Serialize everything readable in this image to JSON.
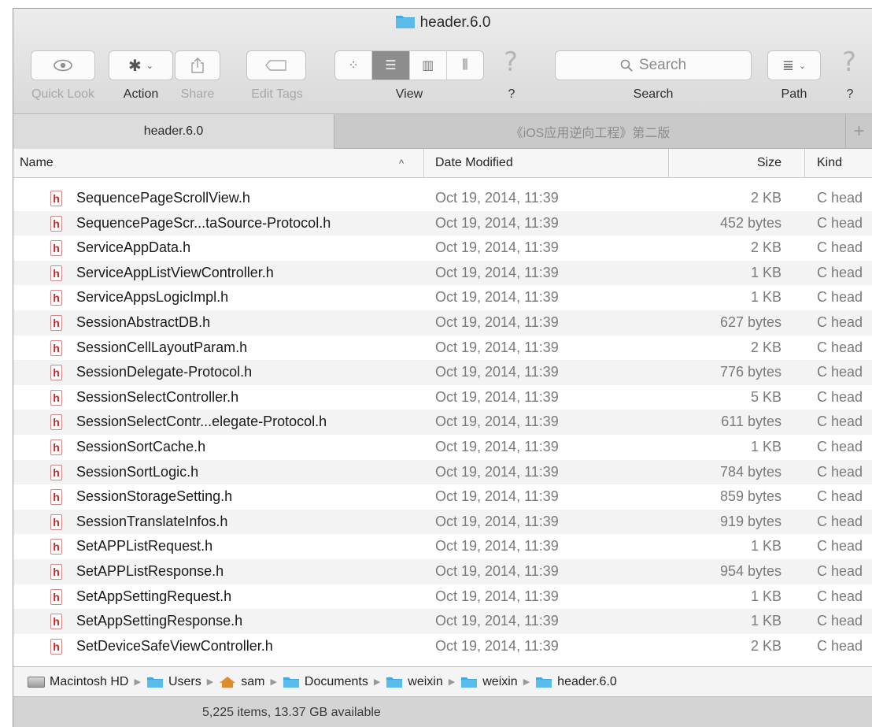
{
  "window": {
    "title": "header.6.0"
  },
  "toolbar": {
    "quick_look_label": "Quick Look",
    "action_label": "Action",
    "share_label": "Share",
    "edit_tags_label": "Edit Tags",
    "view_label": "View",
    "help_label_1": "?",
    "search_placeholder": "Search",
    "search_label": "Search",
    "path_label": "Path",
    "help_label_2": "?"
  },
  "tabs": [
    {
      "label": "header.6.0",
      "active": true
    },
    {
      "label": "《iOS应用逆向工程》第二版",
      "active": false
    }
  ],
  "columns": {
    "name": "Name",
    "sort_indicator": "^",
    "date_modified": "Date Modified",
    "size": "Size",
    "kind": "Kind"
  },
  "files": [
    {
      "name": "SequencePageScrollView.h",
      "date": "Oct 19, 2014, 11:39",
      "size": "2 KB",
      "kind": "C head"
    },
    {
      "name": "SequencePageScr...taSource-Protocol.h",
      "date": "Oct 19, 2014, 11:39",
      "size": "452 bytes",
      "kind": "C head"
    },
    {
      "name": "ServiceAppData.h",
      "date": "Oct 19, 2014, 11:39",
      "size": "2 KB",
      "kind": "C head"
    },
    {
      "name": "ServiceAppListViewController.h",
      "date": "Oct 19, 2014, 11:39",
      "size": "1 KB",
      "kind": "C head"
    },
    {
      "name": "ServiceAppsLogicImpl.h",
      "date": "Oct 19, 2014, 11:39",
      "size": "1 KB",
      "kind": "C head"
    },
    {
      "name": "SessionAbstractDB.h",
      "date": "Oct 19, 2014, 11:39",
      "size": "627 bytes",
      "kind": "C head"
    },
    {
      "name": "SessionCellLayoutParam.h",
      "date": "Oct 19, 2014, 11:39",
      "size": "2 KB",
      "kind": "C head"
    },
    {
      "name": "SessionDelegate-Protocol.h",
      "date": "Oct 19, 2014, 11:39",
      "size": "776 bytes",
      "kind": "C head"
    },
    {
      "name": "SessionSelectController.h",
      "date": "Oct 19, 2014, 11:39",
      "size": "5 KB",
      "kind": "C head"
    },
    {
      "name": "SessionSelectContr...elegate-Protocol.h",
      "date": "Oct 19, 2014, 11:39",
      "size": "611 bytes",
      "kind": "C head"
    },
    {
      "name": "SessionSortCache.h",
      "date": "Oct 19, 2014, 11:39",
      "size": "1 KB",
      "kind": "C head"
    },
    {
      "name": "SessionSortLogic.h",
      "date": "Oct 19, 2014, 11:39",
      "size": "784 bytes",
      "kind": "C head"
    },
    {
      "name": "SessionStorageSetting.h",
      "date": "Oct 19, 2014, 11:39",
      "size": "859 bytes",
      "kind": "C head"
    },
    {
      "name": "SessionTranslateInfos.h",
      "date": "Oct 19, 2014, 11:39",
      "size": "919 bytes",
      "kind": "C head"
    },
    {
      "name": "SetAPPListRequest.h",
      "date": "Oct 19, 2014, 11:39",
      "size": "1 KB",
      "kind": "C head"
    },
    {
      "name": "SetAPPListResponse.h",
      "date": "Oct 19, 2014, 11:39",
      "size": "954 bytes",
      "kind": "C head"
    },
    {
      "name": "SetAppSettingRequest.h",
      "date": "Oct 19, 2014, 11:39",
      "size": "1 KB",
      "kind": "C head"
    },
    {
      "name": "SetAppSettingResponse.h",
      "date": "Oct 19, 2014, 11:39",
      "size": "1 KB",
      "kind": "C head"
    },
    {
      "name": "SetDeviceSafeViewController.h",
      "date": "Oct 19, 2014, 11:39",
      "size": "2 KB",
      "kind": "C head"
    }
  ],
  "file_icon_letter": "h",
  "pathbar": {
    "items": [
      "Macintosh HD",
      "Users",
      "sam",
      "Documents",
      "weixin",
      "weixin",
      "header.6.0"
    ]
  },
  "status": {
    "text": "5,225 items, 13.37 GB available"
  },
  "colors": {
    "folder_blue": "#3fa9e0",
    "header_icon_red": "#c0282a"
  }
}
